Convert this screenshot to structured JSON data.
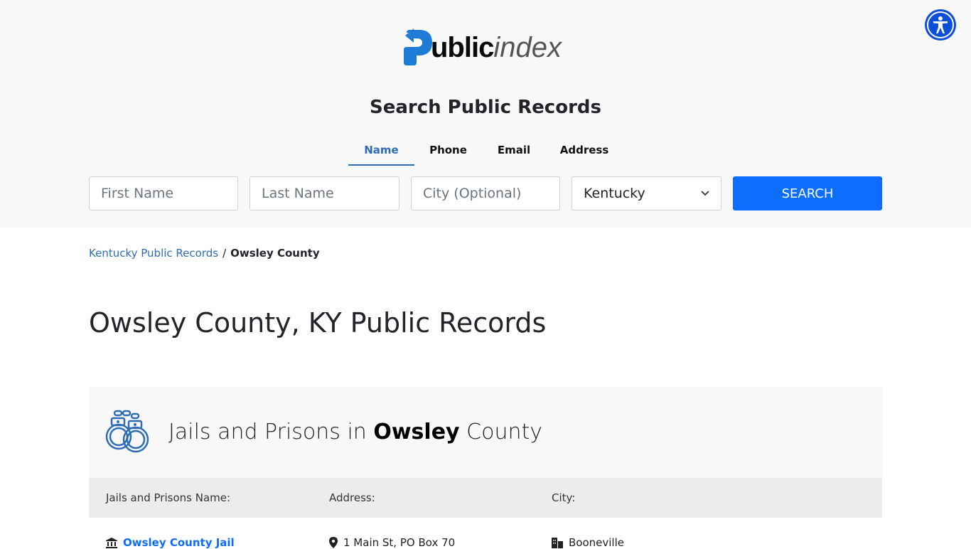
{
  "logo": {
    "bold": "ublic",
    "light": "index",
    "brand_color": "#1e7bd6"
  },
  "accessibility": {
    "label": "Accessibility",
    "color": "#0d4fd8"
  },
  "search": {
    "title": "Search Public Records",
    "tabs": [
      {
        "label": "Name",
        "active": true
      },
      {
        "label": "Phone",
        "active": false
      },
      {
        "label": "Email",
        "active": false
      },
      {
        "label": "Address",
        "active": false
      }
    ],
    "first_name_placeholder": "First Name",
    "last_name_placeholder": "Last Name",
    "city_placeholder": "City (Optional)",
    "state_selected": "Kentucky",
    "button_label": "SEARCH",
    "button_color": "#0d6efd"
  },
  "breadcrumb": {
    "parent": "Kentucky Public Records",
    "separator": "/",
    "current": "Owsley County"
  },
  "page_title": "Owsley County, KY Public Records",
  "section": {
    "title_prefix": "Jails and Prisons in",
    "title_bold": "Owsley",
    "title_suffix": "County",
    "columns": [
      "Jails and Prisons Name:",
      "Address:",
      "City:"
    ],
    "rows": [
      {
        "name": "Owsley County Jail",
        "address": "1 Main St, PO Box 70",
        "city": "Booneville"
      }
    ]
  }
}
